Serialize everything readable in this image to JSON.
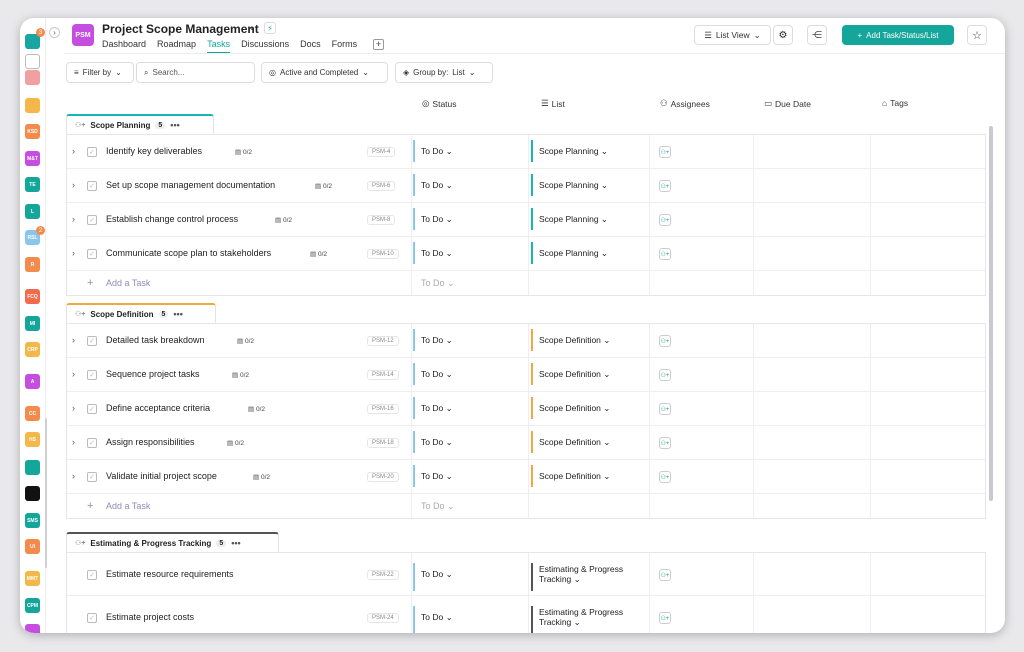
{
  "project": {
    "icon_text": "PSM",
    "title": "Project Scope Management",
    "color": "#c54de0"
  },
  "nav_tabs": [
    "Dashboard",
    "Roadmap",
    "Tasks",
    "Discussions",
    "Docs",
    "Forms"
  ],
  "header_buttons": {
    "list_view": "List View",
    "add_task": "Add Task/Status/List"
  },
  "toolbar": {
    "filter": "Filter by",
    "search_placeholder": "Search...",
    "status_filter": "Active and Completed",
    "group_by_label": "Group by:",
    "group_by_value": "List"
  },
  "columns": {
    "status": "Status",
    "list": "List",
    "assignees": "Assignees",
    "due_date": "Due Date",
    "tags": "Tags"
  },
  "rail": [
    {
      "label": "",
      "color": "#1aa6a0"
    },
    {
      "label": "",
      "color": "#ffffff"
    },
    {
      "label": "",
      "color": "#f0a0a0"
    },
    {
      "label": "",
      "color": "#f4b74a"
    },
    {
      "label": "KSD",
      "color": "#f28b4c"
    },
    {
      "label": "M&T",
      "color": "#c54de0"
    },
    {
      "label": "TE",
      "color": "#14a59b"
    },
    {
      "label": "L",
      "color": "#14a59b"
    },
    {
      "label": "RSL",
      "color": "#8bc6ea"
    },
    {
      "label": "R",
      "color": "#f28b4c"
    },
    {
      "label": "FCQ",
      "color": "#f26b4c"
    },
    {
      "label": "MI",
      "color": "#14a59b"
    },
    {
      "label": "CRP",
      "color": "#f4b74a"
    },
    {
      "label": "A",
      "color": "#c54de0"
    },
    {
      "label": "CC",
      "color": "#f28b4c"
    },
    {
      "label": "HS",
      "color": "#f4b74a"
    },
    {
      "label": "",
      "color": "#14a59b"
    },
    {
      "label": "",
      "color": "#111111"
    },
    {
      "label": "SMS",
      "color": "#14a59b"
    },
    {
      "label": "UI",
      "color": "#f28b4c"
    },
    {
      "label": "MMT",
      "color": "#f4b74a"
    },
    {
      "label": "CPM",
      "color": "#14a59b"
    },
    {
      "label": "",
      "color": "#c54de0"
    }
  ],
  "rail_badges": [
    "3",
    "2"
  ],
  "add_task_label": "Add a Task",
  "add_task_status": "To Do",
  "groups": [
    {
      "name": "Scope Planning",
      "count": "5",
      "color": "#14b8b0",
      "tasks": [
        {
          "name": "Identify key deliverables",
          "sub": "0/2",
          "id": "PSM-4",
          "status": "To Do",
          "list": "Scope Planning"
        },
        {
          "name": "Set up scope management documentation",
          "sub": "0/2",
          "id": "PSM-6",
          "status": "To Do",
          "list": "Scope Planning"
        },
        {
          "name": "Establish change control process",
          "sub": "0/2",
          "id": "PSM-8",
          "status": "To Do",
          "list": "Scope Planning"
        },
        {
          "name": "Communicate scope plan to stakeholders",
          "sub": "0/2",
          "id": "PSM-10",
          "status": "To Do",
          "list": "Scope Planning"
        }
      ]
    },
    {
      "name": "Scope Definition",
      "count": "5",
      "color": "#f4a640",
      "tasks": [
        {
          "name": "Detailed task breakdown",
          "sub": "0/2",
          "id": "PSM-12",
          "status": "To Do",
          "list": "Scope Definition"
        },
        {
          "name": "Sequence project tasks",
          "sub": "0/2",
          "id": "PSM-14",
          "status": "To Do",
          "list": "Scope Definition"
        },
        {
          "name": "Define acceptance criteria",
          "sub": "0/2",
          "id": "PSM-16",
          "status": "To Do",
          "list": "Scope Definition"
        },
        {
          "name": "Assign responsibilities",
          "sub": "0/2",
          "id": "PSM-18",
          "status": "To Do",
          "list": "Scope Definition"
        },
        {
          "name": "Validate initial project scope",
          "sub": "0/2",
          "id": "PSM-20",
          "status": "To Do",
          "list": "Scope Definition"
        }
      ]
    },
    {
      "name": "Estimating & Progress Tracking",
      "count": "5",
      "color": "#555555",
      "tasks": [
        {
          "name": "Estimate resource requirements",
          "sub": "",
          "id": "PSM-22",
          "status": "To Do",
          "list": "Estimating & Progress Tracking"
        },
        {
          "name": "Estimate project costs",
          "sub": "",
          "id": "PSM-24",
          "status": "To Do",
          "list": "Estimating & Progress Tracking"
        }
      ]
    }
  ]
}
